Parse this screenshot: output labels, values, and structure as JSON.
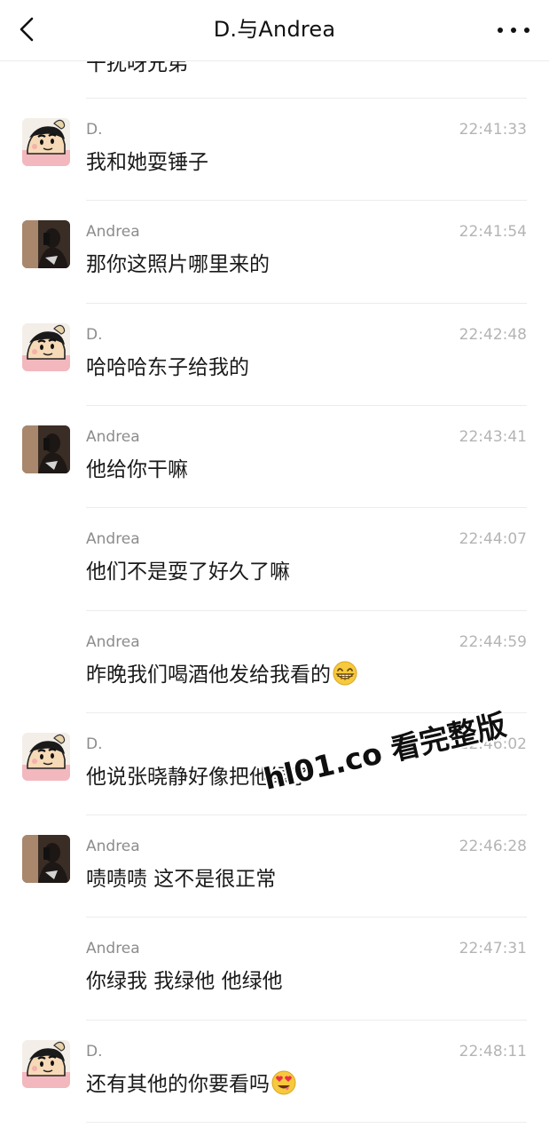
{
  "header": {
    "title": "D.与Andrea",
    "back_icon": "chevron-left-icon",
    "more_icon": "more-dots-icon"
  },
  "partial_message": "干扰呀兄弟",
  "messages": [
    {
      "sender": "D.",
      "time": "22:41:33",
      "text": "我和她耍锤子",
      "avatar": "cartoon-avatar"
    },
    {
      "sender": "Andrea",
      "time": "22:41:54",
      "text": "那你这照片哪里来的",
      "avatar": "photo-avatar"
    },
    {
      "sender": "D.",
      "time": "22:42:48",
      "text": "哈哈哈东子给我的",
      "avatar": "cartoon-avatar"
    },
    {
      "sender": "Andrea",
      "time": "22:43:41",
      "text": "他给你干嘛",
      "avatar": "photo-avatar"
    },
    {
      "sender": "Andrea",
      "time": "22:44:07",
      "text": "他们不是耍了好久了嘛",
      "avatar": null
    },
    {
      "sender": "Andrea",
      "time": "22:44:59",
      "text": "昨晚我们喝酒他发给我看的",
      "avatar": null,
      "emoji": "grinning-face-emoji"
    },
    {
      "sender": "D.",
      "time": "22:46:02",
      "text": "他说张晓静好像把他绿了",
      "avatar": "cartoon-avatar"
    },
    {
      "sender": "Andrea",
      "time": "22:46:28",
      "text": "啧啧啧 这不是很正常",
      "avatar": "photo-avatar"
    },
    {
      "sender": "Andrea",
      "time": "22:47:31",
      "text": "你绿我 我绿他 他绿他",
      "avatar": null
    },
    {
      "sender": "D.",
      "time": "22:48:11",
      "text": "还有其他的你要看吗",
      "avatar": "cartoon-avatar",
      "emoji": "heart-eyes-emoji"
    }
  ],
  "watermark": "hl01.co 看完整版",
  "colors": {
    "name": "#8c8c8c",
    "time": "#b4b4b4",
    "text": "#1a1a1a",
    "separator": "#ececec"
  }
}
